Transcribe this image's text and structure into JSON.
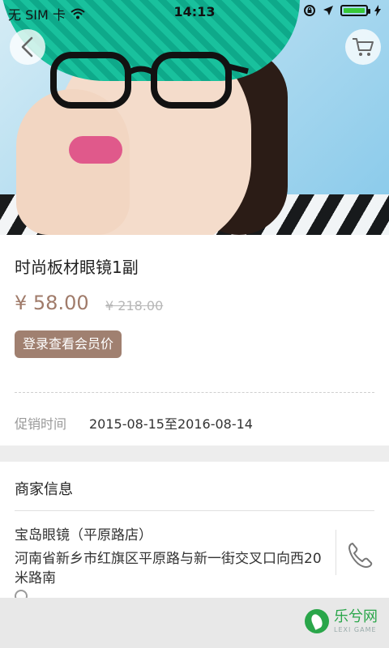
{
  "status_bar": {
    "carrier": "无 SIM 卡",
    "time": "14:13"
  },
  "hero": {
    "image_alt": "photo of a woman wearing black glasses and a green knit hat"
  },
  "product": {
    "title": "时尚板材眼镜1副",
    "price": "¥ 58.00",
    "old_price": "¥ 218.00",
    "member_button": "登录查看会员价",
    "promo_label": "促销时间",
    "promo_period": "2015-08-15至2016-08-14"
  },
  "merchant": {
    "section_title": "商家信息",
    "store_name": "宝岛眼镜（平原路店）",
    "address": "河南省新乡市红旗区平原路与新一街交叉口向西20米路南"
  },
  "watermark": {
    "main": "乐兮网",
    "sub": "LEXI GAME"
  },
  "colors": {
    "price": "#a07b6a",
    "member_button_bg": "#a08070",
    "watermark": "#2aa64a"
  },
  "icons": [
    "back-icon",
    "cart-icon",
    "phone-icon",
    "location-icon",
    "wifi-icon",
    "battery-icon"
  ]
}
